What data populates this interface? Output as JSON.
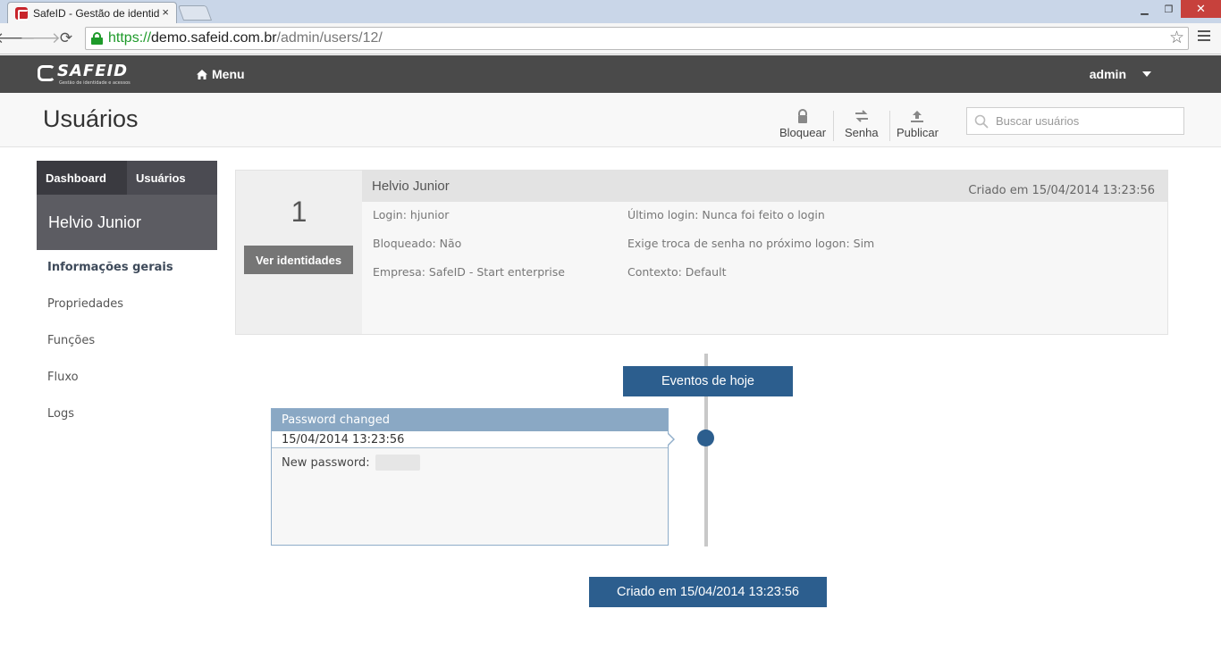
{
  "browser": {
    "tab_title": "SafeID - Gestão de identid",
    "tab_close": "×",
    "url_scheme": "https://",
    "url_host": "demo.safeid.com.br",
    "url_path": "/admin/users/12/"
  },
  "appbar": {
    "logo_text": "SAFEID",
    "logo_tagline": "Gestão de identidade e acessos",
    "menu_label": "Menu",
    "user_label": "admin"
  },
  "page": {
    "title": "Usuários",
    "actions": {
      "lock": "Bloquear",
      "password": "Senha",
      "publish": "Publicar"
    },
    "search_placeholder": "Buscar usuários"
  },
  "sidebar": {
    "tabs": [
      "Dashboard",
      "Usuários"
    ],
    "user_name": "Helvio Junior",
    "items": [
      "Informações gerais",
      "Propriedades",
      "Funções",
      "Fluxo",
      "Logs"
    ]
  },
  "card": {
    "identity_count": "1",
    "button_label": "Ver identidades",
    "name": "Helvio Junior",
    "created": "Criado em 15/04/2014 13:23:56",
    "login": "Login: hjunior",
    "blocked": "Bloqueado: Não",
    "company": "Empresa: SafeID - Start enterprise",
    "last_login": "Último login: Nunca foi feito o login",
    "password_change": "Exige troca de senha no próximo logon: Sim",
    "context": "Contexto: Default"
  },
  "timeline": {
    "today_label": "Eventos de hoje",
    "event_title": "Password changed",
    "event_date": "15/04/2014 13:23:56",
    "event_detail_label": "New password:",
    "created_label": "Criado em 15/04/2014 13:23:56"
  },
  "colors": {
    "appbar": "#4a4a4a",
    "accent_blue": "#2c5e8e",
    "event_header": "#8aa8c4",
    "secure_green": "#1e9a2a"
  }
}
